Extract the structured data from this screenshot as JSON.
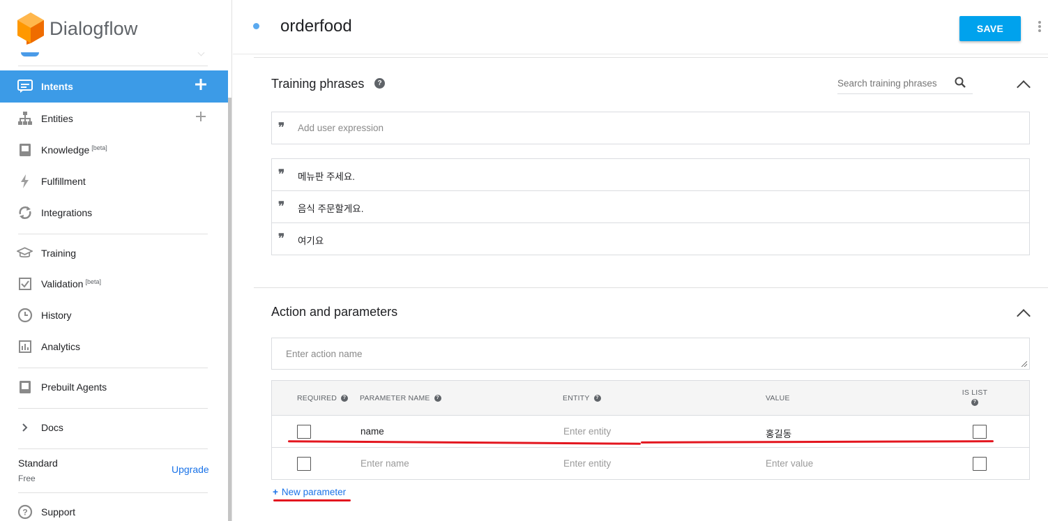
{
  "brand": {
    "name": "Dialogflow"
  },
  "sidebar": {
    "items": [
      {
        "label": "Intents",
        "icon": "chat-bubble-icon",
        "active": true,
        "add": true
      },
      {
        "label": "Entities",
        "icon": "sitemap-icon",
        "add": true
      },
      {
        "label": "Knowledge",
        "badge": "[beta]",
        "icon": "book-icon"
      },
      {
        "label": "Fulfillment",
        "icon": "bolt-icon"
      },
      {
        "label": "Integrations",
        "icon": "sync-icon"
      },
      {
        "label": "Training",
        "icon": "graduation-cap-icon"
      },
      {
        "label": "Validation",
        "badge": "[beta]",
        "icon": "checkbox-icon"
      },
      {
        "label": "History",
        "icon": "clock-icon"
      },
      {
        "label": "Analytics",
        "icon": "bar-chart-icon"
      },
      {
        "label": "Prebuilt Agents",
        "icon": "agent-book-icon"
      },
      {
        "label": "Docs",
        "icon": "chevron-right-icon"
      },
      {
        "label": "Support",
        "icon": "help-circle-icon"
      }
    ],
    "plan": {
      "name": "Standard",
      "tier": "Free",
      "upgrade_label": "Upgrade"
    }
  },
  "header": {
    "intent_name": "orderfood",
    "save_label": "SAVE"
  },
  "training": {
    "title": "Training phrases",
    "search_placeholder": "Search training phrases",
    "add_placeholder": "Add user expression",
    "phrases": [
      "메뉴판 주세요.",
      "음식 주문할게요.",
      "여기요"
    ]
  },
  "action": {
    "title": "Action and parameters",
    "action_placeholder": "Enter action name",
    "columns": {
      "required": "REQUIRED",
      "name": "PARAMETER NAME",
      "entity": "ENTITY",
      "value": "VALUE",
      "is_list": "IS LIST"
    },
    "rows": [
      {
        "name": "name",
        "entity": "Enter entity",
        "value": "홍길동"
      },
      {
        "name": "Enter name",
        "entity": "Enter entity",
        "value": "Enter value"
      }
    ],
    "new_param_label": "New parameter"
  },
  "colors": {
    "accent": "#3c9be7",
    "save": "#00a2ed",
    "link": "#1a73e8",
    "annotation": "#e3161f"
  }
}
